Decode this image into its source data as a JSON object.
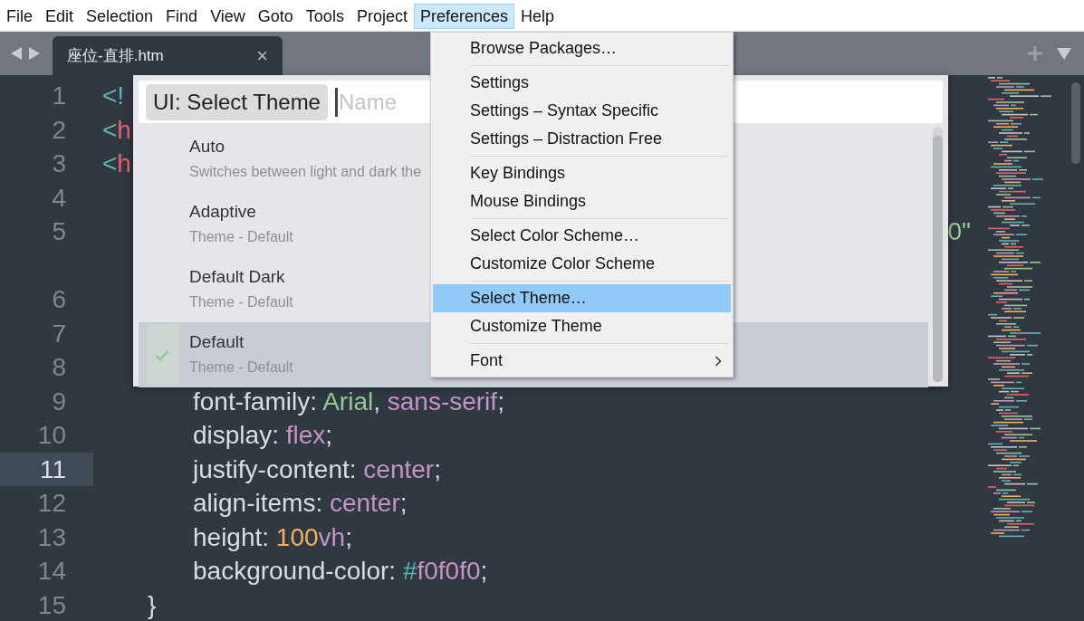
{
  "menu_bar": [
    {
      "label": "File",
      "selected": false
    },
    {
      "label": "Edit",
      "selected": false
    },
    {
      "label": "Selection",
      "selected": false
    },
    {
      "label": "Find",
      "selected": false
    },
    {
      "label": "View",
      "selected": false
    },
    {
      "label": "Goto",
      "selected": false
    },
    {
      "label": "Tools",
      "selected": false
    },
    {
      "label": "Project",
      "selected": false
    },
    {
      "label": "Preferences",
      "selected": true
    },
    {
      "label": "Help",
      "selected": false
    }
  ],
  "tab_bar": {
    "tabs": [
      {
        "label": "座位-直排.htm",
        "close": "×",
        "selected": true
      }
    ]
  },
  "editor": {
    "lines": [
      {
        "number": "1",
        "current": false,
        "wrapped": false,
        "tokens": [
          {
            "kind": "punct",
            "text": "<!"
          }
        ]
      },
      {
        "number": "2",
        "current": false,
        "wrapped": false,
        "tokens": [
          {
            "kind": "punct",
            "text": "<"
          },
          {
            "kind": "tag",
            "text": "h"
          }
        ]
      },
      {
        "number": "3",
        "current": false,
        "wrapped": false,
        "tokens": [
          {
            "kind": "punct",
            "text": "<"
          },
          {
            "kind": "tag",
            "text": "h"
          }
        ]
      },
      {
        "number": "4",
        "current": false,
        "wrapped": false
      },
      {
        "number": "5",
        "current": false,
        "wrapped": true,
        "tokens": [
          {
            "kind": "string",
            "text": "0\""
          }
        ]
      },
      {
        "number": "6",
        "current": false,
        "wrapped": false
      },
      {
        "number": "7",
        "current": false,
        "wrapped": false
      },
      {
        "number": "8",
        "current": false,
        "wrapped": false
      },
      {
        "number": "9",
        "current": false,
        "wrapped": false,
        "tokens": [
          {
            "kind": "plain",
            "text": "\t\tfont-family: "
          },
          {
            "kind": "string",
            "text": "Arial"
          },
          {
            "kind": "plain",
            "text": ", "
          },
          {
            "kind": "value",
            "text": "sans-serif"
          },
          {
            "kind": "plain",
            "text": ";"
          }
        ]
      },
      {
        "number": "10",
        "current": false,
        "wrapped": false,
        "tokens": [
          {
            "kind": "plain",
            "text": "\t\tdisplay: "
          },
          {
            "kind": "value",
            "text": "flex"
          },
          {
            "kind": "plain",
            "text": ";"
          }
        ]
      },
      {
        "number": "11",
        "current": true,
        "wrapped": false,
        "tokens": [
          {
            "kind": "plain",
            "text": "\t\tjustify-content: "
          },
          {
            "kind": "value",
            "text": "center"
          },
          {
            "kind": "plain",
            "text": ";"
          }
        ]
      },
      {
        "number": "12",
        "current": false,
        "wrapped": false,
        "tokens": [
          {
            "kind": "plain",
            "text": "\t\talign-items: "
          },
          {
            "kind": "value",
            "text": "center"
          },
          {
            "kind": "plain",
            "text": ";"
          }
        ]
      },
      {
        "number": "13",
        "current": false,
        "wrapped": false,
        "tokens": [
          {
            "kind": "plain",
            "text": "\t\theight: "
          },
          {
            "kind": "number",
            "text": "100"
          },
          {
            "kind": "value",
            "text": "vh"
          },
          {
            "kind": "plain",
            "text": ";"
          }
        ]
      },
      {
        "number": "14",
        "current": false,
        "wrapped": false,
        "tokens": [
          {
            "kind": "plain",
            "text": "\t\tbackground-color: "
          },
          {
            "kind": "punct",
            "text": "#"
          },
          {
            "kind": "value",
            "text": "f0f0f0"
          },
          {
            "kind": "plain",
            "text": ";"
          }
        ]
      },
      {
        "number": "15",
        "current": false,
        "wrapped": false,
        "tokens": [
          {
            "kind": "plain",
            "text": "\t}"
          }
        ]
      }
    ]
  },
  "quick_panel": {
    "prefix": "UI: Select Theme",
    "placeholder": "Name",
    "items": [
      {
        "title": "Auto",
        "subtitle": "Switches between light and dark the",
        "selected": false
      },
      {
        "title": "Adaptive",
        "subtitle": "Theme - Default",
        "selected": false
      },
      {
        "title": "Default Dark",
        "subtitle": "Theme - Default",
        "selected": false
      },
      {
        "title": "Default",
        "subtitle": "Theme - Default",
        "selected": true
      }
    ]
  },
  "menu": {
    "items": [
      {
        "kind": "item",
        "label": "Browse Packages…",
        "selected": false
      },
      {
        "kind": "separator"
      },
      {
        "kind": "item",
        "label": "Settings",
        "selected": false
      },
      {
        "kind": "item",
        "label": "Settings – Syntax Specific",
        "selected": false
      },
      {
        "kind": "item",
        "label": "Settings – Distraction Free",
        "selected": false
      },
      {
        "kind": "separator"
      },
      {
        "kind": "item",
        "label": "Key Bindings",
        "selected": false
      },
      {
        "kind": "item",
        "label": "Mouse Bindings",
        "selected": false
      },
      {
        "kind": "separator"
      },
      {
        "kind": "item",
        "label": "Select Color Scheme…",
        "selected": false
      },
      {
        "kind": "item",
        "label": "Customize Color Scheme",
        "selected": false
      },
      {
        "kind": "separator"
      },
      {
        "kind": "item",
        "label": "Select Theme…",
        "selected": true
      },
      {
        "kind": "item",
        "label": "Customize Theme",
        "selected": false
      },
      {
        "kind": "separator"
      },
      {
        "kind": "submenu",
        "label": "Font",
        "selected": false
      }
    ]
  }
}
